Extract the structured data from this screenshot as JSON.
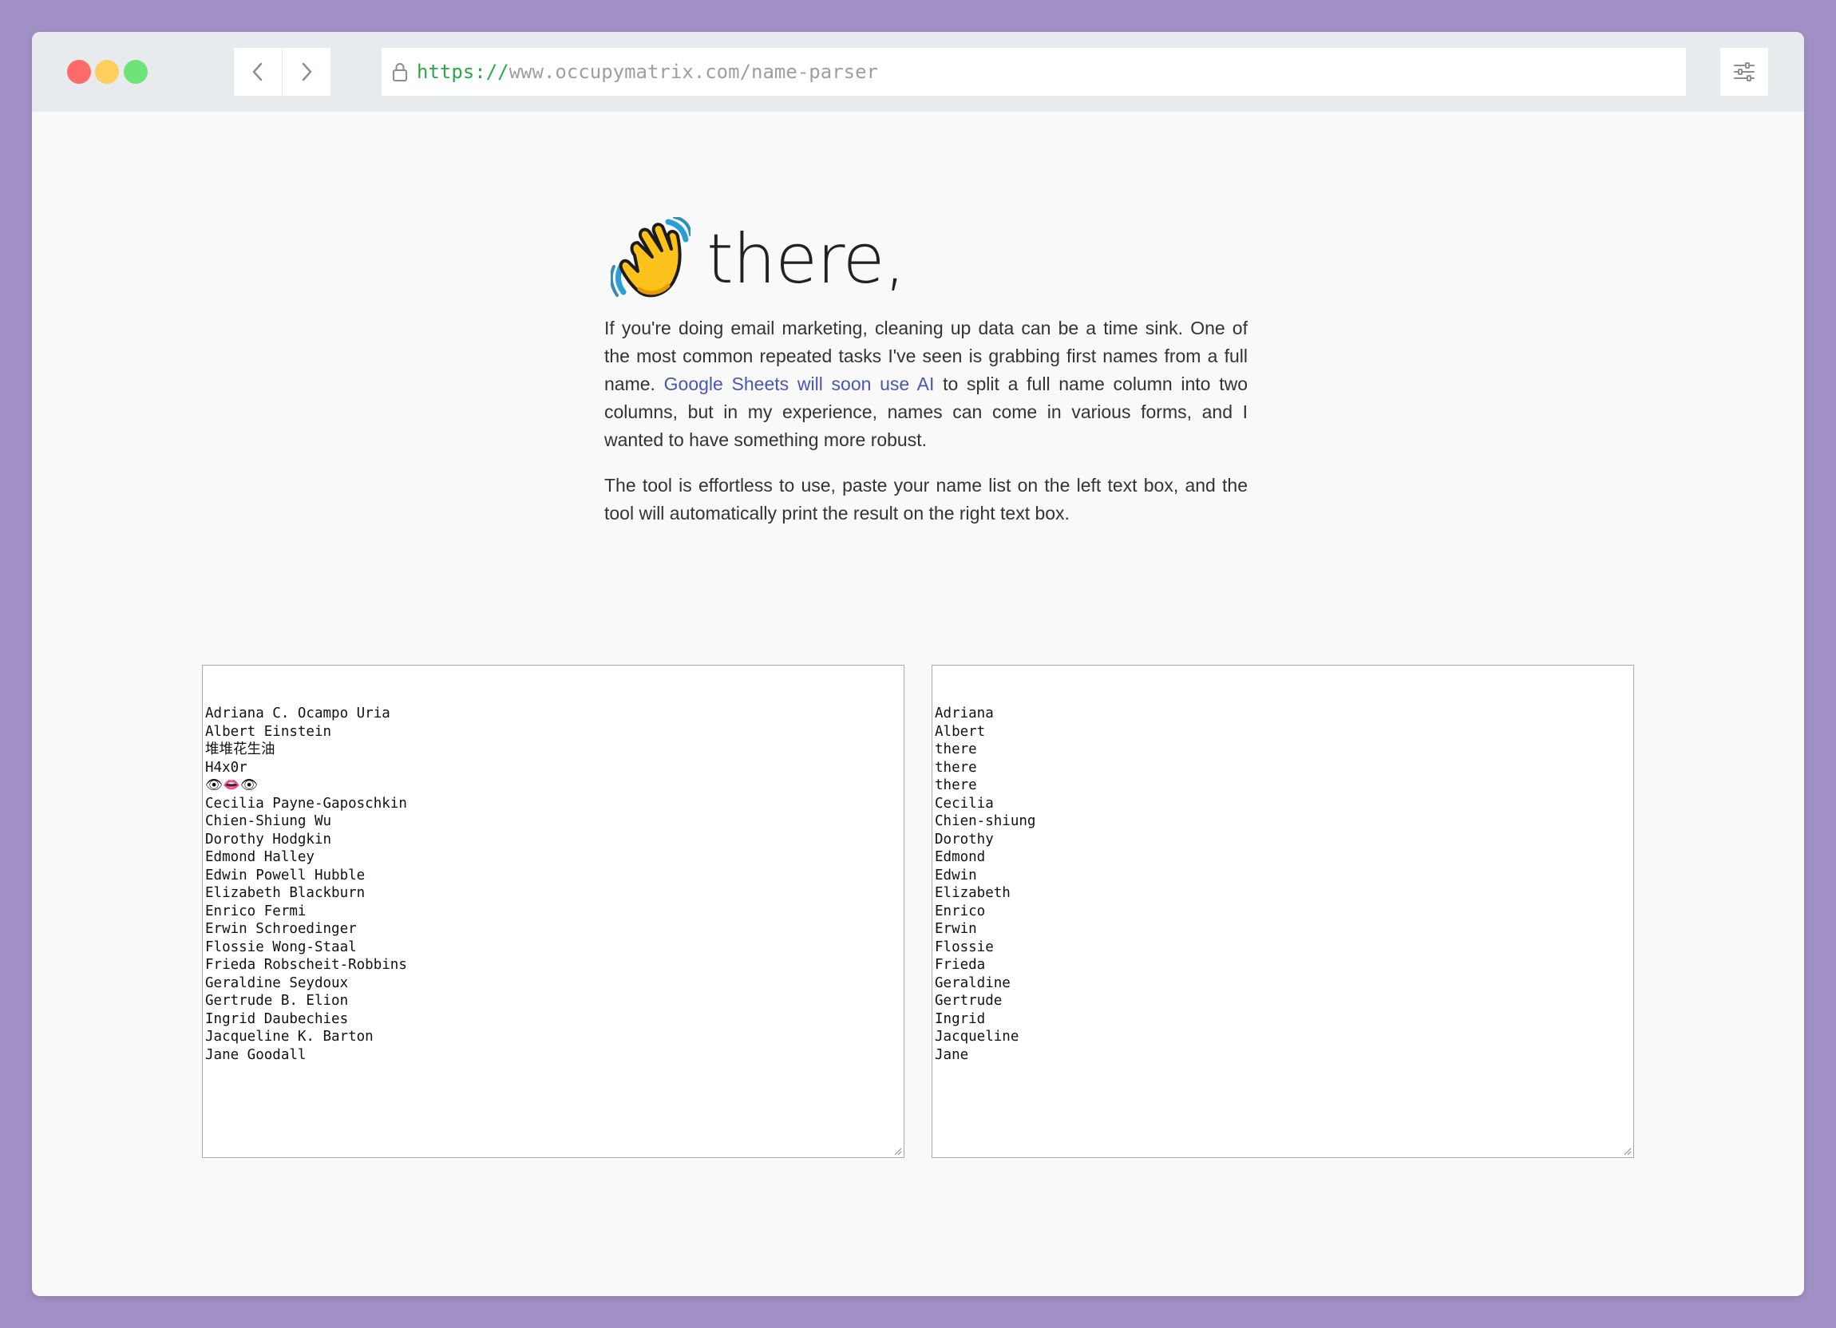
{
  "browser": {
    "url_scheme": "https://",
    "url_rest": "www.occupymatrix.com/name-parser",
    "icons": {
      "back": "chevron-left-icon",
      "forward": "chevron-right-icon",
      "lock": "lock-icon",
      "settings": "sliders-icon"
    }
  },
  "page": {
    "headline_emoji": "waving-hand-icon",
    "headline_text": "there,",
    "para1_before": "If you're doing email marketing, cleaning up data can be a time sink. One of the most common repeated tasks I've seen is grabbing first names from a full name. ",
    "para1_link": "Google Sheets will soon use AI",
    "para1_after": " to split a full name column into two columns, but in my experience, names can come in various forms, and I wanted to have something more robust.",
    "para2": "The tool is effortless to use, paste your name list on the left text box, and the tool will automatically print the result on the right text box."
  },
  "input_names": [
    "Adriana C. Ocampo Uria",
    "Albert Einstein",
    "堆堆花生油",
    "H4x0r",
    "👁👄👁",
    "Cecilia Payne-Gaposchkin",
    "Chien-Shiung Wu",
    "Dorothy Hodgkin",
    "Edmond Halley",
    "Edwin Powell Hubble",
    "Elizabeth Blackburn",
    "Enrico Fermi",
    "Erwin Schroedinger",
    "Flossie Wong-Staal",
    "Frieda Robscheit-Robbins",
    "Geraldine Seydoux",
    "Gertrude B. Elion",
    "Ingrid Daubechies",
    "Jacqueline K. Barton",
    "Jane Goodall"
  ],
  "output_names": [
    "Adriana",
    "Albert",
    "there",
    "there",
    "there",
    "Cecilia",
    "Chien-shiung",
    "Dorothy",
    "Edmond",
    "Edwin",
    "Elizabeth",
    "Enrico",
    "Erwin",
    "Flossie",
    "Frieda",
    "Geraldine",
    "Gertrude",
    "Ingrid",
    "Jacqueline",
    "Jane"
  ],
  "colors": {
    "background": "#a190c5",
    "titlebar": "#e7ebee",
    "page": "#f9f9f9",
    "link": "#4a55b5",
    "url_scheme": "#2ba84a",
    "url_text": "#9aa0a6"
  }
}
